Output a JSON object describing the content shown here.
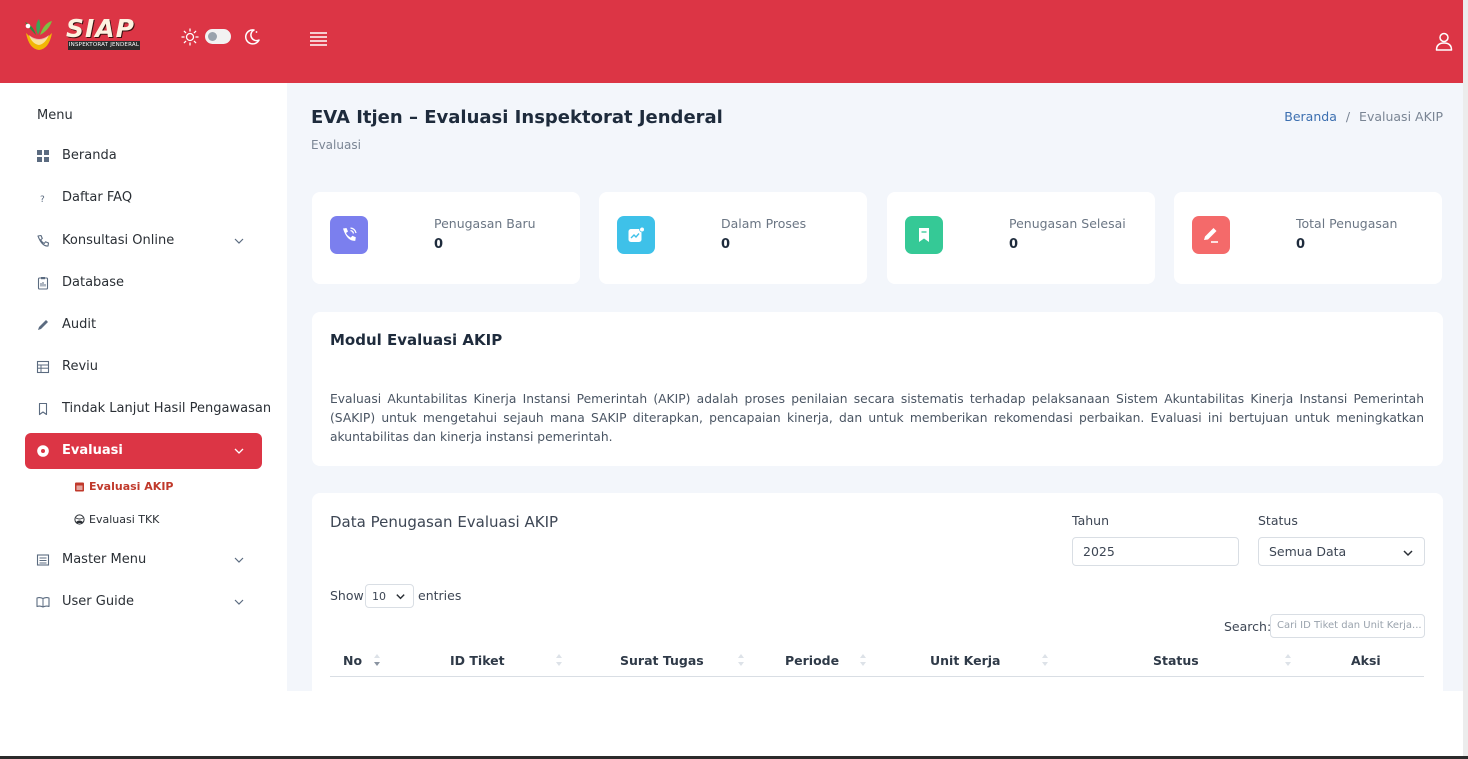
{
  "header": {
    "logo_text": "SIAP",
    "logo_subtext": "INSPEKTORAT JENDERAL",
    "brand_color": "#dc3545"
  },
  "sidebar": {
    "title": "Menu",
    "items": [
      {
        "label": "Beranda",
        "icon": "grid-icon"
      },
      {
        "label": "Daftar FAQ",
        "icon": "question-icon"
      },
      {
        "label": "Konsultasi Online",
        "icon": "phone-icon",
        "expandable": true
      },
      {
        "label": "Database",
        "icon": "clipboard-icon"
      },
      {
        "label": "Audit",
        "icon": "pencil-icon"
      },
      {
        "label": "Reviu",
        "icon": "table-icon"
      },
      {
        "label": "Tindak Lanjut Hasil Pengawasan",
        "icon": "bookmark-icon"
      },
      {
        "label": "Evaluasi",
        "icon": "gear-icon",
        "expandable": true,
        "active": true
      },
      {
        "label": "Master Menu",
        "icon": "list-icon",
        "expandable": true
      },
      {
        "label": "User Guide",
        "icon": "book-icon",
        "expandable": true
      }
    ],
    "subitems": [
      {
        "label": "Evaluasi AKIP",
        "icon": "calendar-icon",
        "active": true
      },
      {
        "label": "Evaluasi TKK",
        "icon": "globe-icon"
      }
    ]
  },
  "page": {
    "title": "EVA Itjen – Evaluasi Inspektorat Jenderal",
    "subtitle": "Evaluasi",
    "breadcrumb": [
      "Beranda",
      "Evaluasi AKIP"
    ],
    "breadcrumb_sep": "/"
  },
  "stats": [
    {
      "label": "Penugasan Baru",
      "value": "0",
      "color": "#7b7fee",
      "icon": "phone-call-icon"
    },
    {
      "label": "Dalam Proses",
      "value": "0",
      "color": "#3ec1e9",
      "icon": "chart-image-icon"
    },
    {
      "label": "Penugasan Selesai",
      "value": "0",
      "color": "#35c996",
      "icon": "bookmark-icon"
    },
    {
      "label": "Total Penugasan",
      "value": "0",
      "color": "#f46a6a",
      "icon": "edit-icon"
    }
  ],
  "info": {
    "title": "Modul Evaluasi AKIP",
    "text": "Evaluasi Akuntabilitas Kinerja Instansi Pemerintah (AKIP) adalah proses penilaian secara sistematis terhadap pelaksanaan Sistem Akuntabilitas Kinerja Instansi Pemerintah (SAKIP) untuk mengetahui sejauh mana SAKIP diterapkan, pencapaian kinerja, dan untuk memberikan rekomendasi perbaikan. Evaluasi ini bertujuan untuk meningkatkan akuntabilitas dan kinerja instansi pemerintah."
  },
  "table": {
    "title": "Data Penugasan Evaluasi AKIP",
    "filters": {
      "year_label": "Tahun",
      "year_value": "2025",
      "status_label": "Status",
      "status_value": "Semua Data"
    },
    "show_label": "Show",
    "page_length": "10",
    "entries_label": "entries",
    "search_label": "Search:",
    "search_placeholder": "Cari ID Tiket dan Unit Kerja...",
    "columns": [
      "No",
      "ID Tiket",
      "Surat Tugas",
      "Periode",
      "Unit Kerja",
      "Status",
      "Aksi"
    ]
  }
}
